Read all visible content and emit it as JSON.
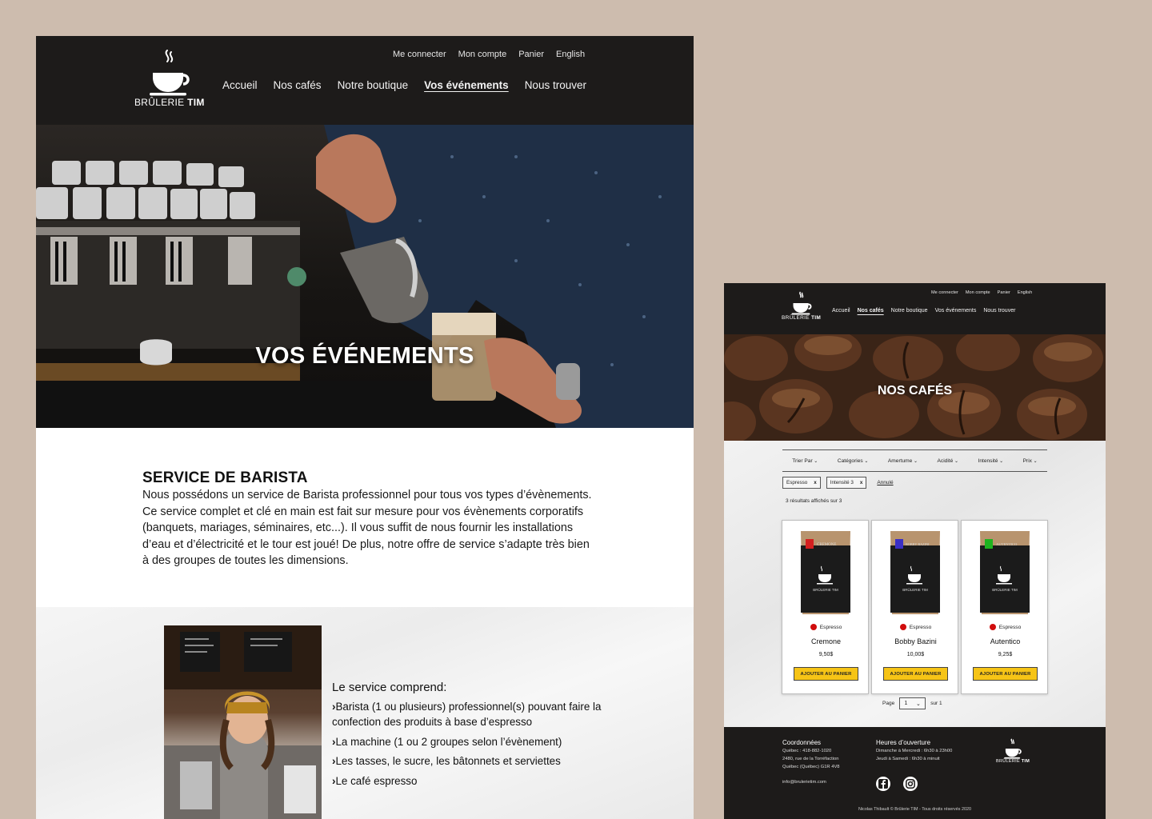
{
  "colors": {
    "background": "#cdbcae",
    "header": "#1d1b1a",
    "accent_button": "#f6c416",
    "intensity_dot": "#d00c0c"
  },
  "left": {
    "brand": {
      "prefix": "BRÛLERIE",
      "name": "TIM"
    },
    "util_nav": [
      "Me connecter",
      "Mon compte",
      "Panier",
      "English"
    ],
    "main_nav": [
      "Accueil",
      "Nos cafés",
      "Notre boutique",
      "Vos événements",
      "Nous trouver"
    ],
    "active_nav": "Vos événements",
    "hero_title": "VOS ÉVÉNEMENTS",
    "intro": {
      "heading": "SERVICE DE BARISTA",
      "body": "Nous possédons un service de Barista professionnel pour tous vos types d’évènements. Ce service complet et clé en main est fait sur mesure pour vos évènements corporatifs (banquets, mariages, séminaires, etc...). Il vous suffit de nous fournir les installations d’eau et d’électricité et le tour est joué! De plus, notre offre de service s’adapte très bien à des groupes de toutes les dimensions."
    },
    "service": {
      "heading": "Le service comprend:",
      "items": [
        "Barista (1 ou plusieurs) professionnel(s) pouvant faire la confection des produits à base d’espresso",
        "La machine (1 ou 2 groupes selon l’évènement)",
        "Les tasses, le sucre, les bâtonnets et serviettes",
        "Le café espresso"
      ]
    }
  },
  "right": {
    "brand": {
      "prefix": "BRÛLERIE",
      "name": "TIM"
    },
    "util_nav": [
      "Me connecter",
      "Mon compte",
      "Panier",
      "English"
    ],
    "main_nav": [
      "Accueil",
      "Nos cafés",
      "Notre boutique",
      "Vos événements",
      "Nous trouver"
    ],
    "active_nav": "Nos cafés",
    "hero_title": "NOS CAFÉS",
    "filters": [
      "Trier Par",
      "Catégories",
      "Amertume",
      "Acidité",
      "Intensité",
      "Prix"
    ],
    "chips": [
      {
        "label": "Espresso",
        "remove": "x"
      },
      {
        "label": "Intensité 3",
        "remove": "x"
      }
    ],
    "reset_label": "Annulé",
    "result_count": "3 résultats affichés sur 3",
    "products": [
      {
        "bag_label": "CREMONE",
        "label_color": "#d41f1f",
        "category": "Espresso",
        "name": "Cremone",
        "price": "9,50$",
        "button": "AJOUTER AU PANIER"
      },
      {
        "bag_label": "BOBBY BAZINI",
        "label_color": "#3b2fc4",
        "category": "Espresso",
        "name": "Bobby Bazini",
        "price": "10,00$",
        "button": "AJOUTER AU PANIER"
      },
      {
        "bag_label": "AUTENTICO",
        "label_color": "#1fb31f",
        "category": "Espresso",
        "name": "Autentico",
        "price": "9,25$",
        "button": "AJOUTER AU PANIER"
      }
    ],
    "pager": {
      "label": "Page",
      "current": "1",
      "total_label": "sur 1"
    },
    "footer": {
      "contact_title": "Coordonnées",
      "contact_lines": [
        "Québec : 418-882-1020",
        "2480, rue de la Torréfaction",
        "Québec (Québec) G1R 4V8"
      ],
      "email": "info@brulerietim.com",
      "hours_title": "Heures d’ouverture",
      "hours_lines": [
        "Dimanche à Mercredi : 6h30 à 23h00",
        "Jeudi à Samedi : 6h30 à minuit"
      ],
      "socials": [
        "facebook-icon",
        "instagram-icon"
      ],
      "copyright": "Nicolas Thibault © Brûlerie TIM - Tous droits réservés 2020"
    }
  }
}
